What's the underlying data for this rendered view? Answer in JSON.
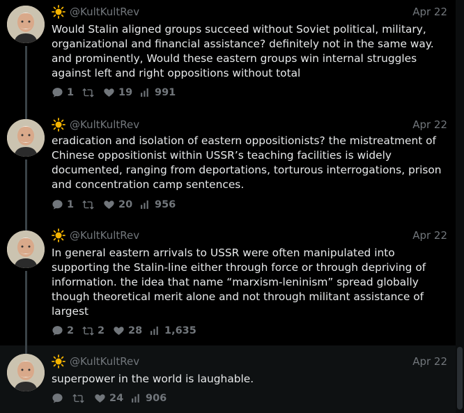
{
  "colors": {
    "background": "#000000",
    "text": "#e7e9ea",
    "muted": "#71767b",
    "rail": "#3a4247"
  },
  "posts": [
    {
      "handle": "@KultKultRev",
      "date": "Apr 22",
      "text": "Would Stalin aligned groups succeed without Soviet political, military,\norganizational and financial assistance? definitely not in the same way.\nand prominently, Would these eastern groups win internal struggles\nagainst left and right oppositions without total",
      "replies": "1",
      "reposts": "",
      "likes": "19",
      "views": "991"
    },
    {
      "handle": "@KultKultRev",
      "date": "Apr 22",
      "text": "eradication and isolation of eastern oppositionists? the mistreatment of\nChinese oppositionist within USSR’s teaching facilities is widely\ndocumented, ranging from deportations, torturous interrogations, prison\nand concentration camp sentences.",
      "replies": "1",
      "reposts": "",
      "likes": "20",
      "views": "956"
    },
    {
      "handle": "@KultKultRev",
      "date": "Apr 22",
      "text": "In general eastern arrivals to USSR were often manipulated into\nsupporting the Stalin-line either through force or through depriving of\ninformation. the idea that name “marxism-leninism” spread globally\nthough theoretical merit alone and not through militant assistance of\nlargest",
      "replies": "2",
      "reposts": "2",
      "likes": "28",
      "views": "1,635"
    },
    {
      "handle": "@KultKultRev",
      "date": "Apr 22",
      "text": "superpower in the world is laughable.",
      "replies": "",
      "reposts": "",
      "likes": "24",
      "views": "906"
    }
  ],
  "icons": {
    "sun": "sun-emoji-icon",
    "reply": "reply-icon",
    "repost": "repost-icon",
    "like": "heart-icon",
    "views": "views-chart-icon"
  }
}
